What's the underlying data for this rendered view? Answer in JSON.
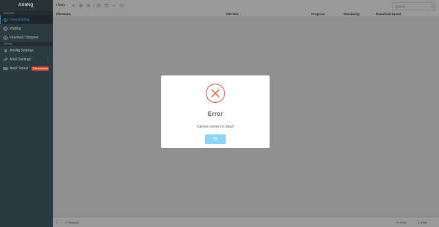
{
  "app": {
    "brand": "AriaNg",
    "brand_sub": "↓"
  },
  "sidebar": {
    "sections": [
      "Download",
      "Settings"
    ],
    "items": [
      {
        "label": "Downloading",
        "icon": "circle-arrow-down-icon"
      },
      {
        "label": "Waiting",
        "icon": "clock-icon"
      },
      {
        "label": "Finished / Stopped",
        "icon": "check-circle-icon"
      },
      {
        "label": "AriaNg Settings",
        "icon": "gear-icon"
      },
      {
        "label": "Aria2 Settings",
        "icon": "gears-icon"
      },
      {
        "label": "Aria2 Status",
        "icon": "server-icon",
        "badge": "Disconnected"
      }
    ]
  },
  "toolbar": {
    "new_label": "New",
    "search_placeholder": "Search"
  },
  "table": {
    "columns": [
      "File Name",
      "File Size",
      "Progress",
      "Remaining",
      "Download Speed"
    ]
  },
  "footer": {
    "shortcut_label": "Shortcut",
    "download_speed": "0 B/s",
    "upload_speed": "0 B/s"
  },
  "dialog": {
    "title": "Error",
    "message": "Cannot connect to aria2!",
    "ok_label": "OK",
    "accent": "#dd6b55"
  }
}
